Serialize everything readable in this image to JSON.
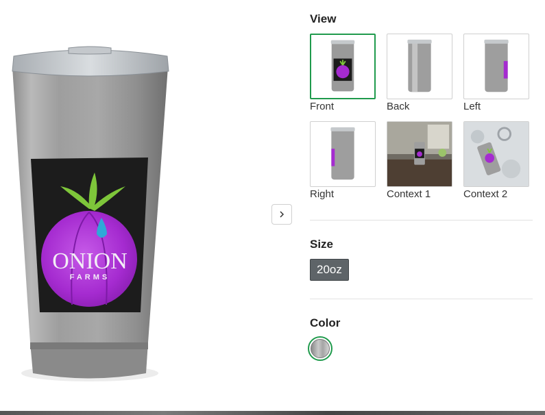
{
  "product": {
    "logo_line1": "ONION",
    "logo_line2": "FARMS"
  },
  "view": {
    "title": "View",
    "thumbs": [
      {
        "label": "Front"
      },
      {
        "label": "Back"
      },
      {
        "label": "Left"
      },
      {
        "label": "Right"
      },
      {
        "label": "Context 1"
      },
      {
        "label": "Context 2"
      }
    ],
    "selected": "Front"
  },
  "size": {
    "title": "Size",
    "selected_label": "20oz"
  },
  "color": {
    "title": "Color"
  },
  "colors": {
    "accent": "#1f9a4c",
    "logo_purple": "#a52bd0",
    "leaf_green": "#7ec63a",
    "drop_blue": "#2fa8d8",
    "size_button_bg": "#5e6468"
  },
  "icons": {
    "next": "chevron-right-icon"
  }
}
